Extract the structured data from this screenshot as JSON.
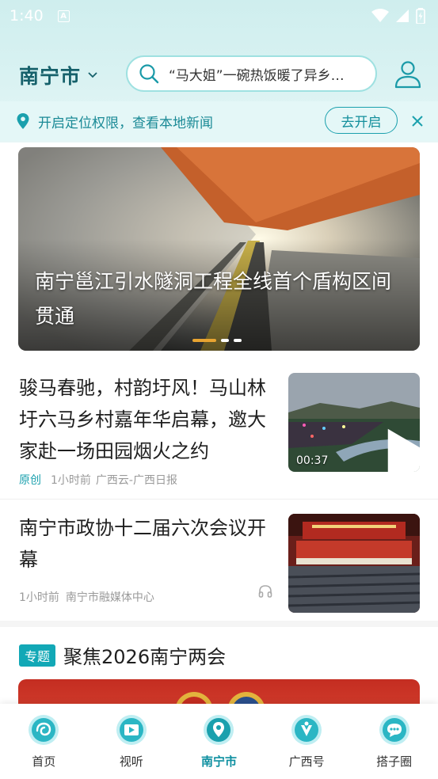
{
  "status_bar": {
    "time": "1:40",
    "notification_letter": "A"
  },
  "header": {
    "city": "南宁市",
    "search_text": "“马大姐”一碗热饭暖了异乡…"
  },
  "location_bar": {
    "text": "开启定位权限，查看本地新闻",
    "button_label": "去开启"
  },
  "banner": {
    "title": "南宁邕江引水隧洞工程全线首个盾构区间贯通",
    "dots_count": 3,
    "active_dot": 0
  },
  "news": [
    {
      "title": "骏马春驰，村韵圩风！马山林圩六马乡村嘉年华启幕，邀大家赴一场田园烟火之约",
      "tag": "原创",
      "time": "1小时前",
      "source": "广西云-广西日报",
      "duration": "00:37"
    },
    {
      "title": "南宁市政协十二届六次会议开幕",
      "time": "1小时前",
      "source": "南宁市融媒体中心"
    }
  ],
  "topic": {
    "badge": "专题",
    "title": "聚焦2026南宁两会"
  },
  "bottom_nav": [
    {
      "label": "首页",
      "icon": "home-swirl-icon"
    },
    {
      "label": "视听",
      "icon": "video-film-icon"
    },
    {
      "label": "南宁市",
      "icon": "location-pin-icon",
      "active": true
    },
    {
      "label": "广西号",
      "icon": "guangxi-flower-icon"
    },
    {
      "label": "搭子圈",
      "icon": "chat-bubble-icon"
    }
  ],
  "colors": {
    "accent": "#1aa0ad",
    "city_text": "#16616b",
    "active_nav": "#0d8fa0",
    "dot_active": "#e8a431"
  }
}
